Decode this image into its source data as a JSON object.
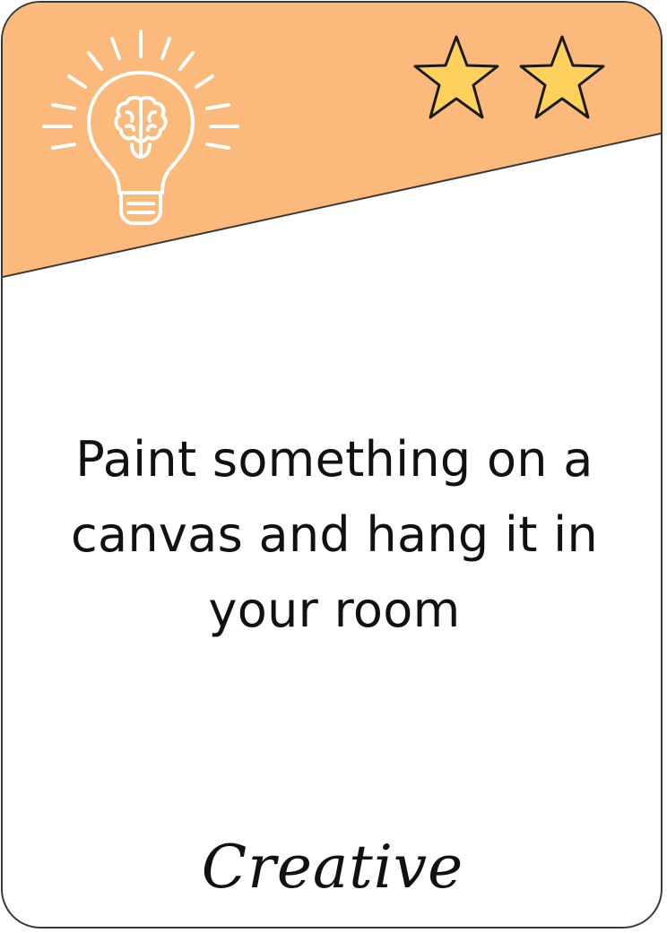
{
  "card": {
    "prompt": "Paint something on a canvas and hang it in your room",
    "category": "Creative",
    "difficulty_stars": 2,
    "icon": "lightbulb-brain-icon",
    "colors": {
      "header": "#FBBA7C",
      "star_fill": "#FDD15C",
      "icon_stroke": "#FFFFFF",
      "border": "#3A3A3A",
      "text": "#111111"
    }
  }
}
